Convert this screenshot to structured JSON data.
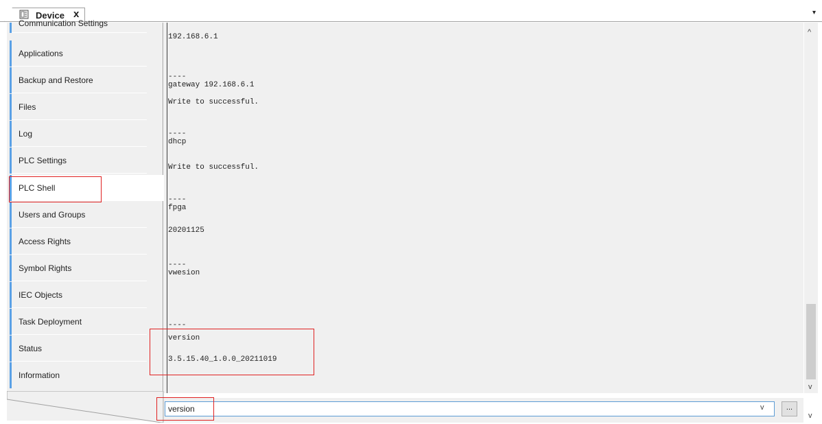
{
  "tab": {
    "title": "Device",
    "close": "x",
    "dropdown": "▾"
  },
  "sidebar": {
    "items": [
      {
        "label": "Communication Settings",
        "partial": true
      },
      {
        "label": "Applications"
      },
      {
        "label": "Backup and Restore"
      },
      {
        "label": "Files"
      },
      {
        "label": "Log"
      },
      {
        "label": "PLC Settings"
      },
      {
        "label": "PLC Shell",
        "active": true
      },
      {
        "label": "Users and Groups"
      },
      {
        "label": "Access Rights"
      },
      {
        "label": "Symbol Rights"
      },
      {
        "label": "IEC Objects"
      },
      {
        "label": "Task Deployment"
      },
      {
        "label": "Status"
      },
      {
        "label": "Information"
      }
    ]
  },
  "shell": {
    "lines": [
      "192.168.6.1",
      "----",
      "gateway 192.168.6.1",
      "Write to successful.",
      "----",
      "dhcp",
      "Write to successful.",
      "----",
      "fpga",
      "20201125",
      "----",
      "vwesion",
      "----",
      "version",
      "3.5.15.40_1.0.0_20211019"
    ],
    "command_value": "version",
    "more_label": "...",
    "scroll_up": "^",
    "scroll_down": "v",
    "combo_arrow": "v"
  },
  "colors": {
    "accent": "#5aa0e6",
    "highlight": "#e02020",
    "panel": "#f0f0f0"
  }
}
